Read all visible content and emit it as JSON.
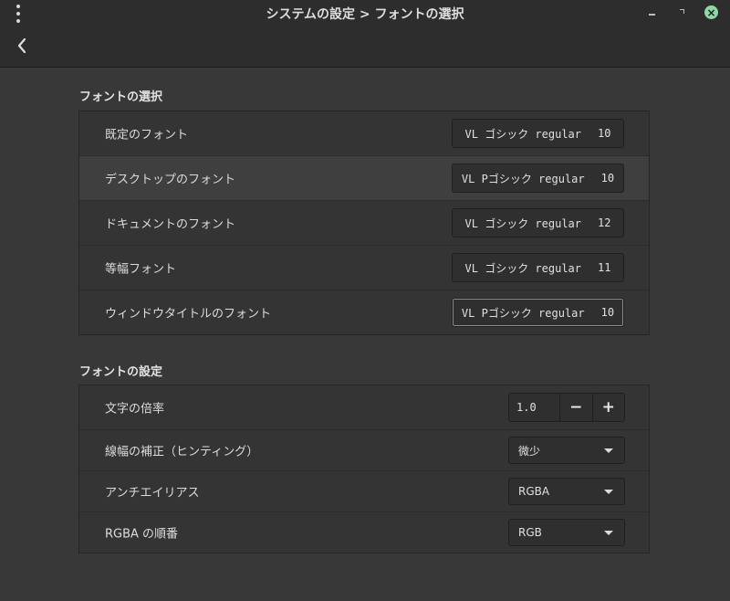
{
  "window": {
    "title": "システムの設定 > フォントの選択",
    "icons": {
      "menu": "kebab-menu-icon",
      "minimize": "minimize-icon",
      "maximize": "maximize-icon",
      "close": "close-icon",
      "back": "chevron-left-icon"
    },
    "close_color": "#8fd7a7"
  },
  "font_selection": {
    "title": "フォントの選択",
    "rows": [
      {
        "label": "既定のフォント",
        "font": "VL ゴシック regular",
        "size": "10"
      },
      {
        "label": "デスクトップのフォント",
        "font": "VL Pゴシック regular",
        "size": "10"
      },
      {
        "label": "ドキュメントのフォント",
        "font": "VL ゴシック regular",
        "size": "12"
      },
      {
        "label": "等幅フォント",
        "font": "VL ゴシック regular",
        "size": "11"
      },
      {
        "label": "ウィンドウタイトルのフォント",
        "font": "VL Pゴシック regular",
        "size": "10"
      }
    ]
  },
  "font_settings": {
    "title": "フォントの設定",
    "scale": {
      "label": "文字の倍率",
      "value": "1.0",
      "minus": "−",
      "plus": "+"
    },
    "hinting": {
      "label": "線幅の補正（ヒンティング）",
      "value": "微少"
    },
    "antialias": {
      "label": "アンチエイリアス",
      "value": "RGBA"
    },
    "rgba_order": {
      "label": "RGBA の順番",
      "value": "RGB"
    }
  }
}
